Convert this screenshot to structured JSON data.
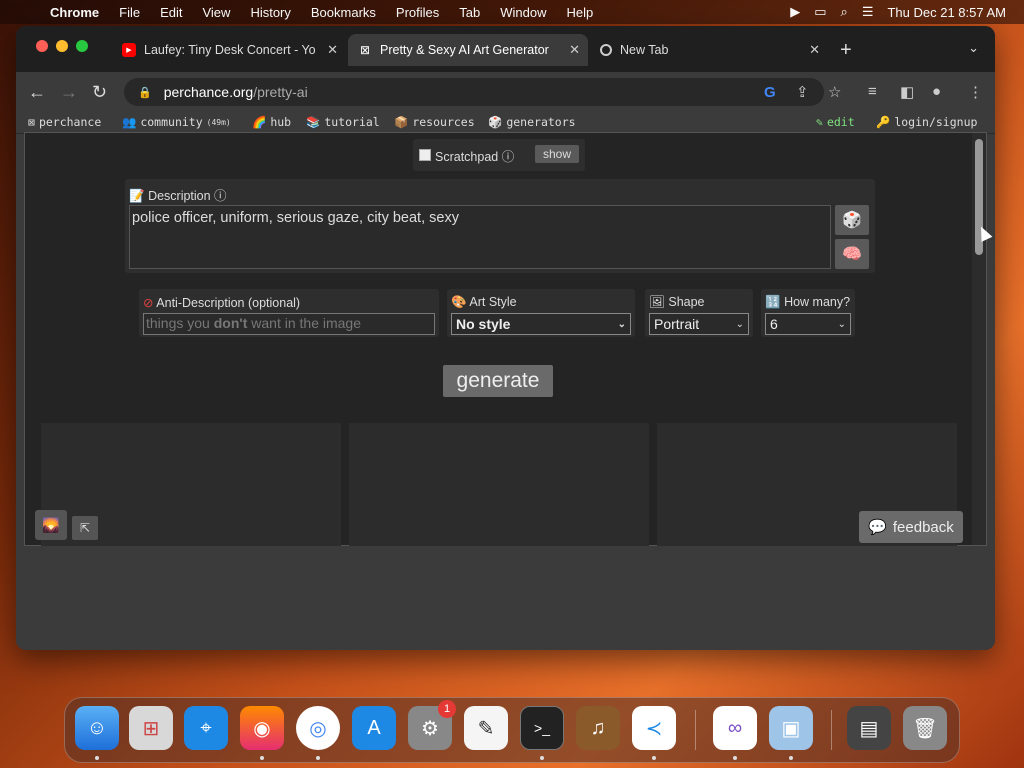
{
  "menubar": {
    "items": [
      "Chrome",
      "File",
      "Edit",
      "View",
      "History",
      "Bookmarks",
      "Profiles",
      "Tab",
      "Window",
      "Help"
    ],
    "datetime": "Thu Dec 21  8:57 AM"
  },
  "browser": {
    "tabs": [
      {
        "title": "Laufey: Tiny Desk Concert - Yo",
        "favicon": "youtube-icon",
        "active": false
      },
      {
        "title": "Pretty & Sexy AI Art Generator",
        "favicon": "perchance-icon",
        "active": true
      },
      {
        "title": "New Tab",
        "favicon": "chrome-icon",
        "active": false
      }
    ],
    "url_host": "perchance.org",
    "url_path": "/pretty-ai"
  },
  "bookmarks": {
    "items": [
      {
        "label": "perchance",
        "icon": "⊠"
      },
      {
        "label": "community",
        "icon": "👥",
        "extra": "(49m)"
      },
      {
        "label": "hub",
        "icon": "🌈"
      },
      {
        "label": "tutorial",
        "icon": "📚"
      },
      {
        "label": "resources",
        "icon": "📦"
      },
      {
        "label": "generators",
        "icon": "🎲"
      }
    ],
    "edit_label": "edit",
    "login_label": "login/signup"
  },
  "page": {
    "scratchpad_label": "Scratchpad ⓘ",
    "show_label": "show",
    "description_label": "Description ⓘ",
    "description_value": "police officer, uniform, serious gaze, city beat, sexy",
    "anti_label": "Anti-Description (optional)",
    "anti_placeholder_pre": "things you ",
    "anti_placeholder_bold": "don't",
    "anti_placeholder_post": " want in the image",
    "art_style_label": "Art Style",
    "art_style_value": "No style",
    "shape_label": "Shape",
    "shape_value": "Portrait",
    "how_many_label": "How many?",
    "how_many_value": "6",
    "generate_label": "generate",
    "feedback_label": "feedback"
  },
  "dock": {
    "apps": [
      "Finder",
      "Launchpad",
      "Safari",
      "Firefox",
      "Chrome",
      "App Store",
      "System Settings",
      "TextEdit",
      "Terminal",
      "GarageBand",
      "VS Code",
      "Visual Studio",
      "Preview",
      "Downloads",
      "Trash"
    ],
    "settings_badge": "1"
  }
}
